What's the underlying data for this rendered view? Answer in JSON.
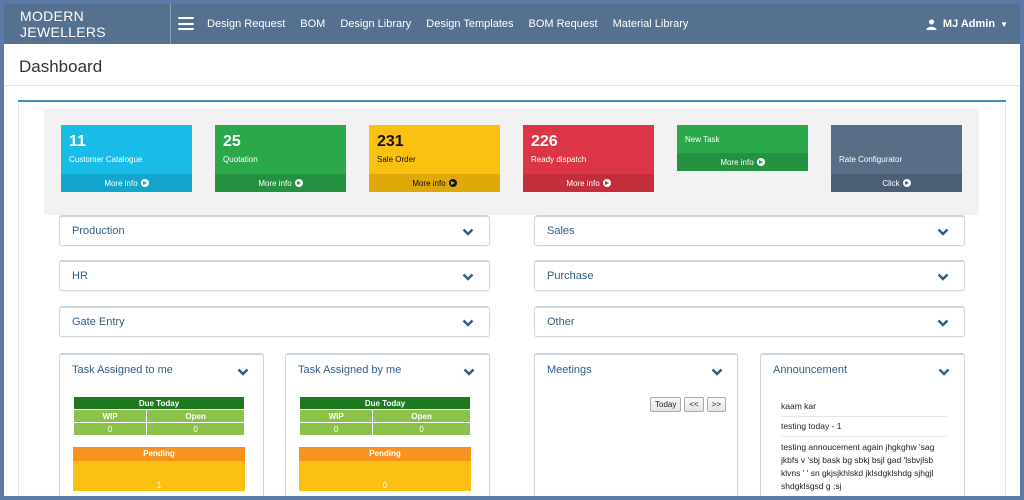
{
  "brand": "MODERN JEWELLERS",
  "nav": [
    "Design Request",
    "BOM",
    "Design Library",
    "Design Templates",
    "BOM Request",
    "Material Library"
  ],
  "user": {
    "name": "MJ Admin"
  },
  "page_title": "Dashboard",
  "cards": [
    {
      "number": "11",
      "label": "Customer Catalogue",
      "footer": "More info"
    },
    {
      "number": "25",
      "label": "Quotation",
      "footer": "More info"
    },
    {
      "number": "231",
      "label": "Sale Order",
      "footer": "More info"
    },
    {
      "number": "226",
      "label": "Ready dispatch",
      "footer": "More info"
    },
    {
      "number": "",
      "label": "New Task",
      "footer": "More info"
    },
    {
      "number": "",
      "label": "Rate Configurator",
      "footer": "Click"
    }
  ],
  "panels": {
    "production": "Production",
    "sales": "Sales",
    "hr": "HR",
    "purchase": "Purchase",
    "gate_entry": "Gate Entry",
    "other": "Other"
  },
  "task_assigned_to_me": {
    "title": "Task Assigned to me",
    "due_today": "Due Today",
    "wip_label": "WIP",
    "open_label": "Open",
    "wip": "0",
    "open": "0",
    "pending_label": "Pending",
    "pending": "1"
  },
  "task_assigned_by_me": {
    "title": "Task Assigned by me",
    "due_today": "Due Today",
    "wip_label": "WIP",
    "open_label": "Open",
    "wip": "0",
    "open": "0",
    "pending_label": "Pending",
    "pending": "0"
  },
  "meetings": {
    "title": "Meetings",
    "today": "Today",
    "prev": "<<",
    "next": ">>"
  },
  "announcement": {
    "title": "Announcement",
    "items": [
      "kaam kar",
      "testing today - 1",
      "testing annoucement again jhgkghw 'sag jkbfs v 'sbj bask bg sbkj bsjl gad 'lsbvjlsb klvns ' ' sn gkjsjkhlskd jklsdgklshdg sjhgjl shdgklsgsd g ;sj"
    ]
  },
  "colors": {
    "topbar": "#56708f",
    "blue": "#18bce6",
    "green": "#2ba84a",
    "yellow": "#fbc112",
    "red": "#dc3545",
    "slate": "#5a6d86",
    "accent": "#3c8dbc"
  },
  "icons": {
    "menu": "hamburger-icon",
    "user": "user-icon",
    "caret": "caret-down-icon",
    "more_info": "arrow-circle-right-icon",
    "panel_toggle": "chevron-down-icon"
  }
}
